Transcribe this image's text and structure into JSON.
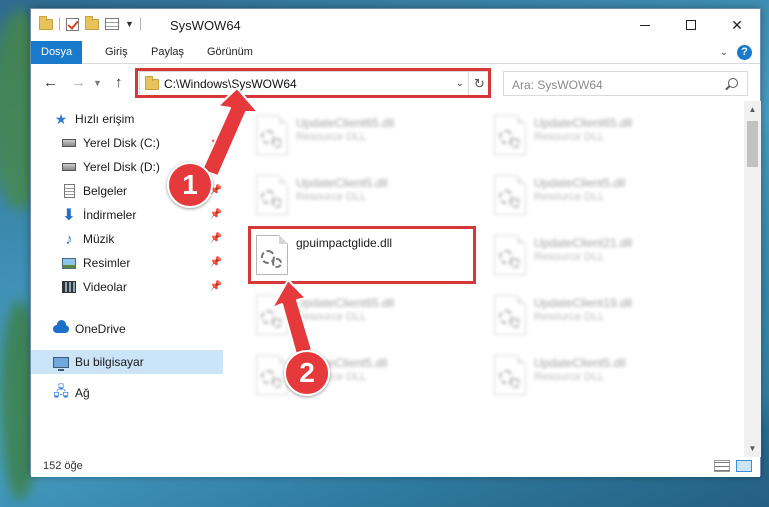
{
  "window": {
    "title": "SysWOW64",
    "controls": {
      "minimize": "—",
      "maximize": "□",
      "close": "✕"
    }
  },
  "ribbon": {
    "tabs": [
      {
        "label": "Dosya",
        "active": true
      },
      {
        "label": "Giriş"
      },
      {
        "label": "Paylaş"
      },
      {
        "label": "Görünüm"
      }
    ],
    "help": "?"
  },
  "nav": {
    "back": "←",
    "forward": "→",
    "up": "↑",
    "address": "C:\\Windows\\SysWOW64",
    "search_placeholder": "Ara: SysWOW64"
  },
  "sidebar": {
    "items": [
      {
        "label": "Hızlı erişim",
        "icon": "star-icon"
      },
      {
        "label": "Yerel Disk (C:)",
        "icon": "drive-icon",
        "pinned": true
      },
      {
        "label": "Yerel Disk (D:)",
        "icon": "drive-icon",
        "pinned": true
      },
      {
        "label": "Belgeler",
        "icon": "documents-icon",
        "pinned": true
      },
      {
        "label": "İndirmeler",
        "icon": "download-icon",
        "pinned": true
      },
      {
        "label": "Müzik",
        "icon": "music-icon",
        "pinned": true
      },
      {
        "label": "Resimler",
        "icon": "pictures-icon",
        "pinned": true
      },
      {
        "label": "Videolar",
        "icon": "videos-icon",
        "pinned": true
      },
      {
        "label": "OneDrive",
        "icon": "onedrive-icon"
      },
      {
        "label": "Bu bilgisayar",
        "icon": "this-pc-icon",
        "selected": true
      },
      {
        "label": "Ağ",
        "icon": "network-icon"
      }
    ]
  },
  "files": [
    {
      "name": "UpdateClient65.dll",
      "type": "Resource DLL",
      "blurred": true
    },
    {
      "name": "UpdateClient65.dll",
      "type": "Resource DLL",
      "blurred": true
    },
    {
      "name": "UpdateClient5.dll",
      "type": "Resource DLL",
      "blurred": true
    },
    {
      "name": "UpdateClient5.dll",
      "type": "Resource DLL",
      "blurred": true
    },
    {
      "name": "gpuimpactglide.dll",
      "type": "",
      "blurred": false
    },
    {
      "name": "UpdateClient21.dll",
      "type": "Resource DLL",
      "blurred": true
    },
    {
      "name": "UpdateClient65.dll",
      "type": "Resource DLL",
      "blurred": true
    },
    {
      "name": "UpdateClient19.dll",
      "type": "Resource DLL",
      "blurred": true
    },
    {
      "name": "UpdateClient5.dll",
      "type": "Resource DLL",
      "blurred": true
    },
    {
      "name": "UpdateClient5.dll",
      "type": "Resource DLL",
      "blurred": true
    }
  ],
  "status": {
    "item_count": "152 öğe"
  },
  "annotations": {
    "callout_1": "1",
    "callout_2": "2",
    "highlight_color": "#d6383a"
  }
}
